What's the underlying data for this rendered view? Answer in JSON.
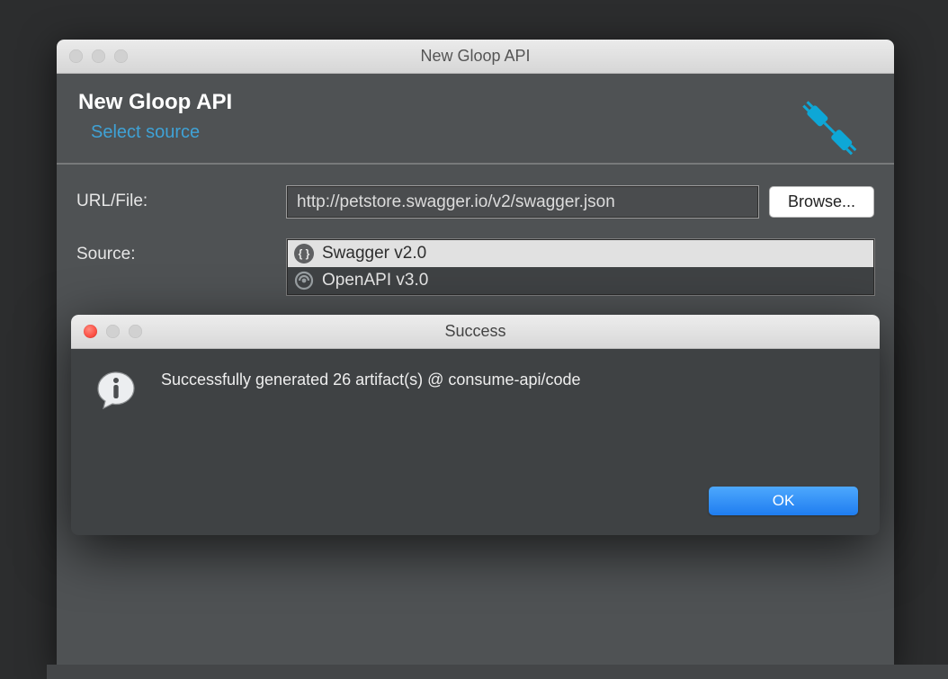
{
  "wizard": {
    "window_title": "New Gloop API",
    "header_title": "New Gloop API",
    "subtitle": "Select source",
    "url_file_label": "URL/File:",
    "url_file_value": "http://petstore.swagger.io/v2/swagger.json",
    "browse_label": "Browse...",
    "source_label": "Source:",
    "source_items": [
      {
        "label": "Swagger v2.0",
        "selected": true
      },
      {
        "label": "OpenAPI v3.0",
        "selected": false
      }
    ]
  },
  "modal": {
    "title": "Success",
    "message": "Successfully generated 26 artifact(s) @ consume-api/code",
    "ok_label": "OK"
  }
}
